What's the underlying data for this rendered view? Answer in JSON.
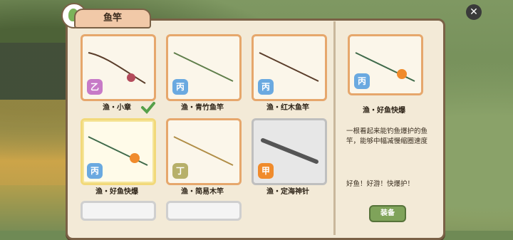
{
  "header": {
    "title": "鱼竿"
  },
  "grid": [
    {
      "name": "渔・小章",
      "tier": "乙",
      "tier_color": "#c77ac7",
      "equipped": true
    },
    {
      "name": "渔・青竹鱼竿",
      "tier": "丙",
      "tier_color": "#6aa9e0"
    },
    {
      "name": "渔・红木鱼竿",
      "tier": "丙",
      "tier_color": "#6aa9e0"
    },
    {
      "name": "渔・好鱼快爆",
      "tier": "丙",
      "tier_color": "#6aa9e0",
      "selected": true
    },
    {
      "name": "渔・简易木竿",
      "tier": "丁",
      "tier_color": "#b7b06a"
    },
    {
      "name": "渔・定海神针",
      "tier": "甲",
      "tier_color": "#f08b2c"
    }
  ],
  "detail": {
    "tier": "丙",
    "name": "渔・好鱼快爆",
    "description": "一根看起来能钓鱼爆护的鱼竿，能够中幅减慢缩圈速度",
    "slogan": "好鱼！好游！快爆护！",
    "equip_label": "装备"
  }
}
